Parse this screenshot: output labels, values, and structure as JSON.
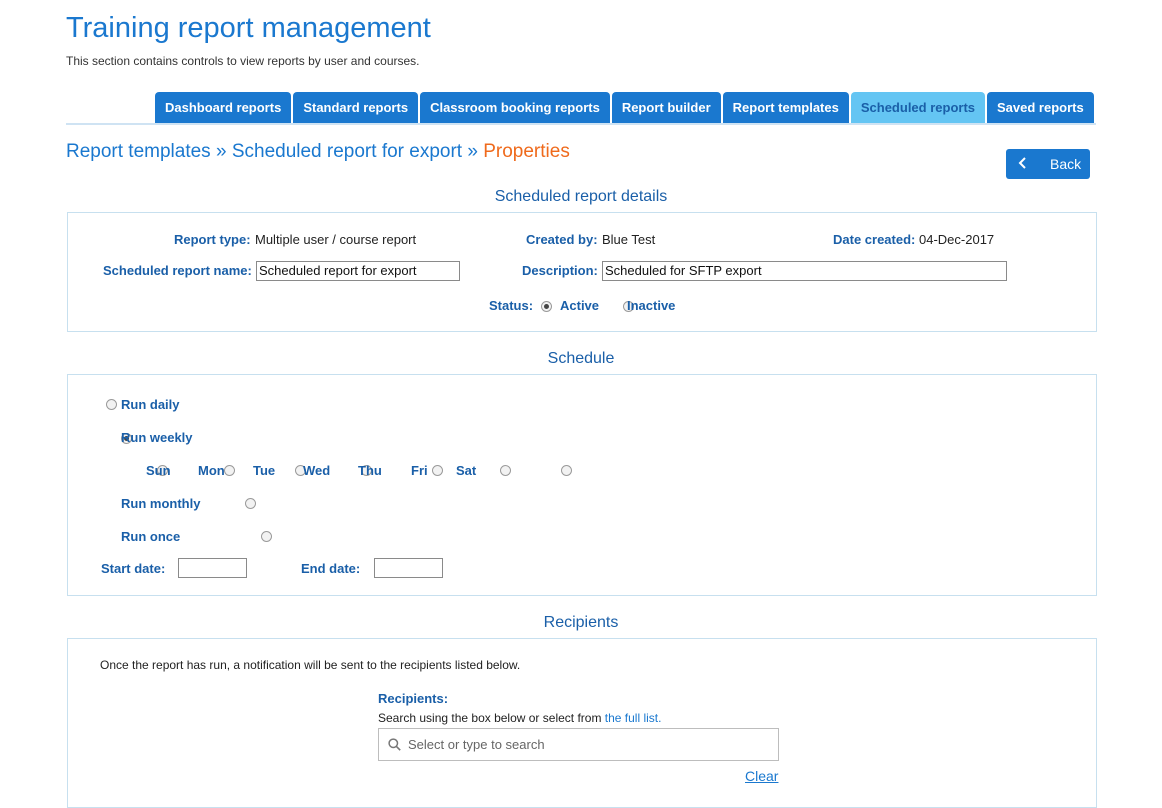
{
  "header": {
    "title": "Training report management",
    "subtitle": "This section contains controls to view reports by user and courses."
  },
  "tabs": [
    {
      "label": "Dashboard reports",
      "active": false
    },
    {
      "label": "Standard reports",
      "active": false
    },
    {
      "label": "Classroom booking reports",
      "active": false
    },
    {
      "label": "Report builder",
      "active": false
    },
    {
      "label": "Report templates",
      "active": false
    },
    {
      "label": "Scheduled reports",
      "active": true
    },
    {
      "label": "Saved reports",
      "active": false
    }
  ],
  "breadcrumb": {
    "part1": "Report templates",
    "sep": "»",
    "part2": "Scheduled report for export",
    "current": "Properties"
  },
  "back_button": {
    "label": "Back",
    "icon": "chevron-left-icon"
  },
  "details": {
    "heading": "Scheduled report details",
    "report_type_label": "Report type:",
    "report_type_value": "Multiple user / course report",
    "created_by_label": "Created by:",
    "created_by_value": "Blue Test",
    "date_created_label": "Date created:",
    "date_created_value": "04-Dec-2017",
    "name_label": "Scheduled report name:",
    "name_value": "Scheduled report for export",
    "description_label": "Description:",
    "description_value": "Scheduled for SFTP export",
    "status_label": "Status:",
    "status_options": [
      {
        "label": "Active",
        "selected": true
      },
      {
        "label": "Inactive",
        "selected": false
      }
    ]
  },
  "schedule": {
    "heading": "Schedule",
    "run_daily": {
      "label": "Run daily",
      "selected": false
    },
    "run_weekly": {
      "label": "Run weekly",
      "selected": true
    },
    "days": [
      {
        "label": "Sun",
        "selected": false
      },
      {
        "label": "Mon",
        "selected": false
      },
      {
        "label": "Tue",
        "selected": false
      },
      {
        "label": "Wed",
        "selected": false
      },
      {
        "label": "Thu",
        "selected": false
      },
      {
        "label": "Fri",
        "selected": false
      },
      {
        "label": "Sat",
        "selected": false
      }
    ],
    "run_monthly": {
      "label": "Run monthly",
      "selected": false
    },
    "run_once": {
      "label": "Run once",
      "selected": false
    },
    "start_date_label": "Start date:",
    "start_date_value": "",
    "end_date_label": "End date:",
    "end_date_value": ""
  },
  "recipients": {
    "heading": "Recipients",
    "note": "Once the report has run, a notification will be sent to the recipients listed below.",
    "label": "Recipients:",
    "help_text": "Search using the box below or select from ",
    "full_list_link": "the full list.",
    "search_placeholder": "Select or type to search",
    "clear_label": "Clear"
  },
  "colors": {
    "brand_blue": "#1a78cf",
    "active_tab": "#64c5f3",
    "breadcrumb_current": "#ef6a1c"
  }
}
